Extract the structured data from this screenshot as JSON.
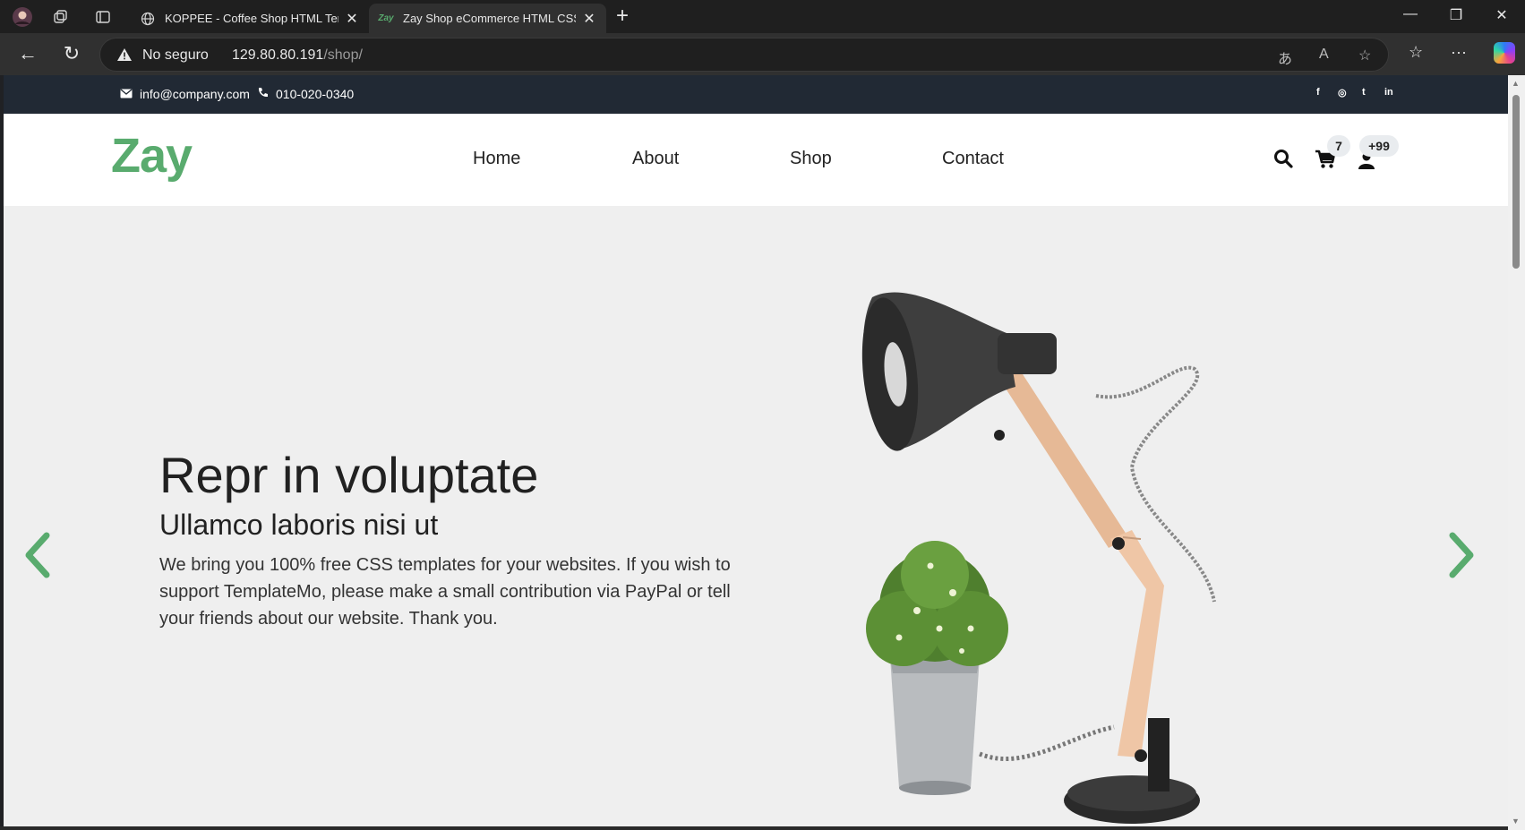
{
  "browser": {
    "tabs": [
      {
        "title": "KOPPEE - Coffee Shop HTML Tem",
        "favicon": "globe-icon"
      },
      {
        "title": "Zay Shop eCommerce HTML CSS",
        "favicon": "Zay"
      }
    ],
    "security_label": "No seguro",
    "url_host": "129.80.80.191",
    "url_path": "/shop/"
  },
  "site": {
    "top_bar": {
      "email": "info@company.com",
      "phone": "010-020-0340",
      "social": [
        "f",
        "◎",
        "t",
        "in"
      ]
    },
    "logo": "Zay",
    "nav": {
      "home": "Home",
      "about": "About",
      "shop": "Shop",
      "contact": "Contact"
    },
    "cart_count": "7",
    "user_count": "+99",
    "hero": {
      "title": "Repr in voluptate",
      "subtitle": "Ullamco laboris nisi ut",
      "description": "We bring you 100% free CSS templates for your websites. If you wish to support TemplateMo, please make a small contribution via PayPal or tell your friends about our website. Thank you."
    },
    "colors": {
      "brand": "#59ab6e",
      "topbar": "#212934",
      "hero_bg": "#efefef"
    }
  }
}
